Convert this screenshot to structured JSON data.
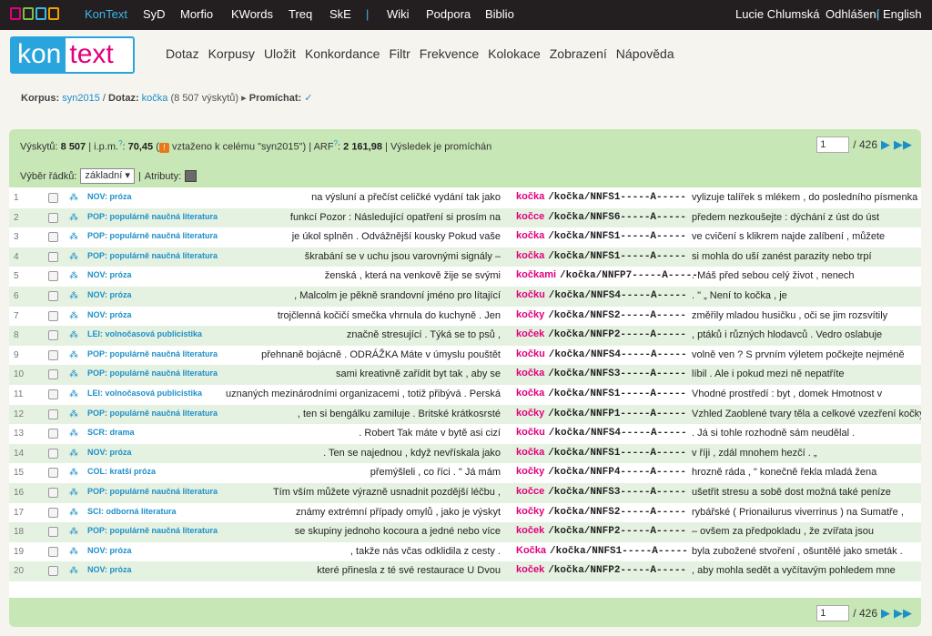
{
  "topbar": {
    "links": [
      "KonText",
      "SyD",
      "Morfio",
      "KWords",
      "Treq",
      "SkE"
    ],
    "separator": "|",
    "links2": [
      "Wiki",
      "Podpora",
      "Biblio"
    ],
    "user": "Lucie Chlumská",
    "logout": "Odhlášení",
    "lang": "English"
  },
  "logo": {
    "kon": "kon",
    "text": "text"
  },
  "menu": [
    "Dotaz",
    "Korpusy",
    "Uložit",
    "Konkordance",
    "Filtr",
    "Frekvence",
    "Kolokace",
    "Zobrazení",
    "Nápověda"
  ],
  "breadcrumb": {
    "corpus_label": "Korpus:",
    "corpus": "syn2015",
    "query_label": "Dotaz:",
    "query": "kočka",
    "query_count": "(8 507 výskytů)",
    "shuffle_label": "Promíchat:",
    "shuffle_mark": "✓"
  },
  "status": {
    "hits_label": "Výskytů:",
    "hits": "8 507",
    "ipm_label": "i.p.m.",
    "ipm": "70,45",
    "ipm_note": "vztaženo k celému \"syn2015\")",
    "arf_label": "ARF",
    "arf": "2 161,98",
    "shuffled": "Výsledek je promíchán"
  },
  "pager": {
    "page": "1",
    "total": "/ 426"
  },
  "rowsel": {
    "label": "Výběr řádků:",
    "value": "základní",
    "attrs_label": "Atributy:"
  },
  "rows": [
    {
      "n": "1",
      "ref": "NOV: próza",
      "left": "na výsluní a přečíst celičké vydání tak jako",
      "kw": "kočka",
      "tag": "/kočka/NNFS1-----A-----",
      "right": "vylizuje talířek s mlékem , do posledního písmenka"
    },
    {
      "n": "2",
      "ref": "POP: populárně naučná literatura",
      "left": "funkcí Pozor : Následující opatření si prosím na",
      "kw": "kočce",
      "tag": "/kočka/NNFS6-----A-----",
      "right": "předem nezkoušejte : dýchání z úst do úst"
    },
    {
      "n": "3",
      "ref": "POP: populárně naučná literatura",
      "left": "je úkol splněn . Odvážnější kousky Pokud vaše",
      "kw": "kočka",
      "tag": "/kočka/NNFS1-----A-----",
      "right": "ve cvičení s klikrem najde zalíbení , můžete"
    },
    {
      "n": "4",
      "ref": "POP: populárně naučná literatura",
      "left": "škrabání se v uchu jsou varovnými signály –",
      "kw": "kočka",
      "tag": "/kočka/NNFS1-----A-----",
      "right": "si mohla do uší zanést parazity nebo trpí"
    },
    {
      "n": "5",
      "ref": "NOV: próza",
      "left": "ženská , která na venkově žije se svými",
      "kw": "kočkami",
      "tag": "/kočka/NNFP7-----A-----",
      "right": ". Máš před sebou celý život , nenech"
    },
    {
      "n": "6",
      "ref": "NOV: próza",
      "left": ", Malcolm je pěkně srandovní jméno pro lítající",
      "kw": "kočku",
      "tag": "/kočka/NNFS4-----A-----",
      "right": ". \" „ Není to kočka , je"
    },
    {
      "n": "7",
      "ref": "NOV: próza",
      "left": "trojčlenná kočičí smečka vhrnula do kuchyně . Jen",
      "kw": "kočky",
      "tag": "/kočka/NNFS2-----A-----",
      "right": "změřily mladou husičku , oči se jim rozsvítily"
    },
    {
      "n": "8",
      "ref": "LEI: volnočasová publicistika",
      "left": "značně stresující . Týká se to psů ,",
      "kw": "koček",
      "tag": "/kočka/NNFP2-----A-----",
      "right": ", ptáků i různých hlodavců . Vedro oslabuje"
    },
    {
      "n": "9",
      "ref": "POP: populárně naučná literatura",
      "left": "přehnaně bojácně . ODRÁŽKA Máte v úmyslu pouštět",
      "kw": "kočku",
      "tag": "/kočka/NNFS4-----A-----",
      "right": "volně ven ? S prvním výletem počkejte nejméně"
    },
    {
      "n": "10",
      "ref": "POP: populárně naučná literatura",
      "left": "sami kreativně zařídit byt tak , aby se",
      "kw": "kočka",
      "tag": "/kočka/NNFS3-----A-----",
      "right": "líbil . Ale i pokud mezi ně nepatříte"
    },
    {
      "n": "11",
      "ref": "LEI: volnočasová publicistika",
      "left": "uznaných mezinárodními organizacemi , totiž přibývá . Perská",
      "kw": "kočka",
      "tag": "/kočka/NNFS1-----A-----",
      "right": "Vhodné prostředí : byt , domek Hmotnost v"
    },
    {
      "n": "12",
      "ref": "POP: populárně naučná literatura",
      "left": ", ten si bengálku zamiluje . Britské krátkosrsté",
      "kw": "kočky",
      "tag": "/kočka/NNFP1-----A-----",
      "right": "Vzhled Zaoblené tvary těla a celkové vzezření kočky"
    },
    {
      "n": "13",
      "ref": "SCR: drama",
      "left": ". Robert Tak máte v bytě asi cizí",
      "kw": "kočku",
      "tag": "/kočka/NNFS4-----A-----",
      "right": ". Já si tohle rozhodně sám neudělal ."
    },
    {
      "n": "14",
      "ref": "NOV: próza",
      "left": ". Ten se najednou , když nevřískala jako",
      "kw": "kočka",
      "tag": "/kočka/NNFS1-----A-----",
      "right": "v říji , zdál mnohem hezčí . „"
    },
    {
      "n": "15",
      "ref": "COL: kratší próza",
      "left": "přemýšleli , co říci . \" Já mám",
      "kw": "kočky",
      "tag": "/kočka/NNFP4-----A-----",
      "right": "hrozně ráda , \" konečně řekla mladá žena"
    },
    {
      "n": "16",
      "ref": "POP: populárně naučná literatura",
      "left": "Tím vším můžete výrazně usnadnit pozdější léčbu ,",
      "kw": "kočce",
      "tag": "/kočka/NNFS3-----A-----",
      "right": "ušetřit stresu a sobě dost možná také peníze"
    },
    {
      "n": "17",
      "ref": "SCI: odborná literatura",
      "left": "známy extrémní případy omylů , jako je výskyt",
      "kw": "kočky",
      "tag": "/kočka/NNFS2-----A-----",
      "right": "rybářské ( Prionailurus viverrinus ) na Sumatře ,"
    },
    {
      "n": "18",
      "ref": "POP: populárně naučná literatura",
      "left": "se skupiny jednoho kocoura a jedné nebo více",
      "kw": "koček",
      "tag": "/kočka/NNFP2-----A-----",
      "right": "– ovšem za předpokladu , že zvířata jsou"
    },
    {
      "n": "19",
      "ref": "NOV: próza",
      "left": ", takže nás včas odklidila z cesty .",
      "kw": "Kočka",
      "tag": "/kočka/NNFS1-----A-----",
      "right": "byla zubožené stvoření , ošuntělé jako smeták ."
    },
    {
      "n": "20",
      "ref": "NOV: próza",
      "left": "které přinesla z té své restaurace U Dvou",
      "kw": "koček",
      "tag": "/kočka/NNFP2-----A-----",
      "right": ", aby mohla sedět a vyčítavým pohledem mne"
    }
  ]
}
